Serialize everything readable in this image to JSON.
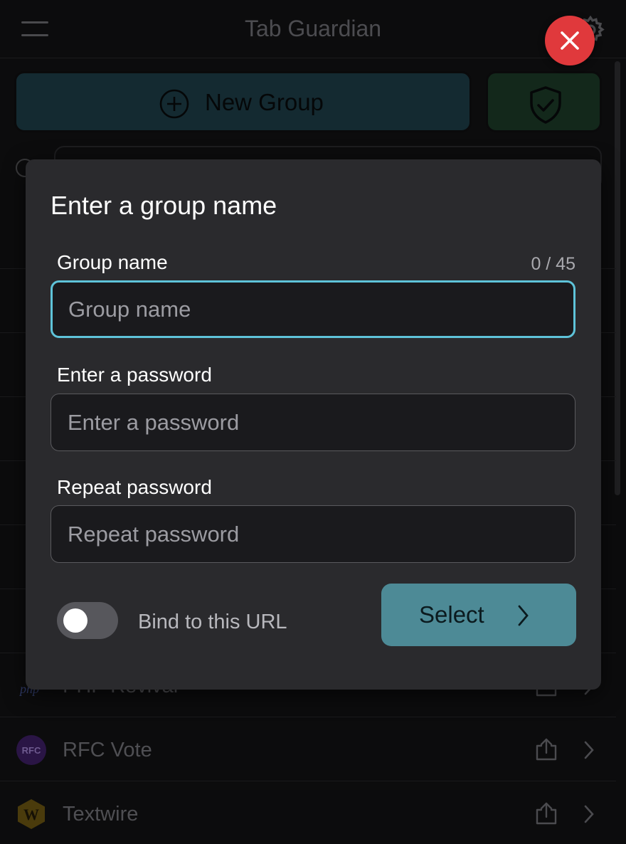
{
  "app": {
    "title": "Tab Guardian"
  },
  "toolbar": {
    "new_group_label": "New Group"
  },
  "groups": [
    {
      "name": "PHP Revival",
      "icon": "php-logo-icon"
    },
    {
      "name": "RFC Vote",
      "icon": "rfc-logo-icon",
      "icon_text": "RFC"
    },
    {
      "name": "Textwire",
      "icon": "textwire-logo-icon",
      "icon_text": "W"
    }
  ],
  "modal": {
    "title": "Enter a group name",
    "group_name": {
      "label": "Group name",
      "placeholder": "Group name",
      "value": "",
      "counter": "0 / 45"
    },
    "password": {
      "label": "Enter a password",
      "placeholder": "Enter a password",
      "value": ""
    },
    "repeat_password": {
      "label": "Repeat password",
      "placeholder": "Repeat password",
      "value": ""
    },
    "bind_url": {
      "label": "Bind to this URL",
      "checked": false
    },
    "select_label": "Select"
  },
  "colors": {
    "accent": "#5ec3d9",
    "select_button": "#4d8a96",
    "close_button": "#e0393c",
    "modal_bg": "#2a2a2d"
  }
}
